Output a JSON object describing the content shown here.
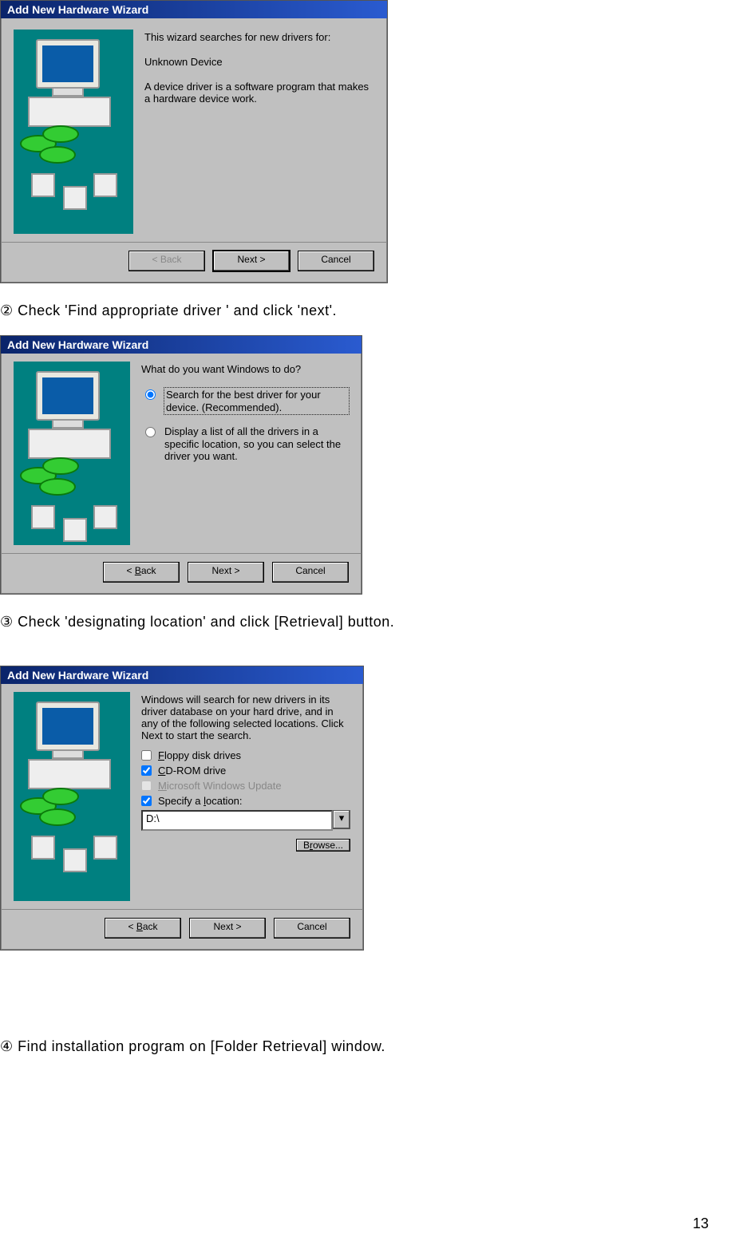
{
  "page_number": "13",
  "instructions": {
    "step2": "② Check 'Find appropriate driver ' and click 'next'.",
    "step3": "③ Check 'designating location' and click [Retrieval] button.",
    "step4": "④ Find installation program on [Folder Retrieval] window."
  },
  "dialog1": {
    "title": "Add New Hardware Wizard",
    "intro": "This wizard searches for new drivers for:",
    "device": "Unknown Device",
    "desc": "A device driver is a software program that makes a hardware device work.",
    "buttons": {
      "back": "< Back",
      "next": "Next >",
      "cancel": "Cancel"
    }
  },
  "dialog2": {
    "title": "Add New Hardware Wizard",
    "prompt": "What do you want Windows to do?",
    "options": {
      "search": "Search for the best driver for your device. (Recommended).",
      "display": "Display a list of all the drivers in a specific location, so you can select the driver you want."
    },
    "buttons": {
      "back_u": "B",
      "back": "ack",
      "next": "Next >",
      "cancel": "Cancel"
    }
  },
  "dialog3": {
    "title": "Add New Hardware Wizard",
    "intro": "Windows will search for new drivers in its driver database on your hard drive, and in any of the following selected locations. Click Next to start the search.",
    "checks": {
      "floppy_u": "F",
      "floppy": "loppy disk drives",
      "cdrom_u": "C",
      "cdrom": "D-ROM drive",
      "wu_u": "M",
      "wu": "icrosoft Windows Update",
      "spec": "Specify a ",
      "spec_u": "l",
      "spec2": "ocation:"
    },
    "location_value": "D:\\",
    "browse_u": "r",
    "browse_pre": "B",
    "browse_post": "owse...",
    "buttons": {
      "back_u": "B",
      "back": "ack",
      "next": "Next >",
      "cancel": "Cancel"
    }
  }
}
